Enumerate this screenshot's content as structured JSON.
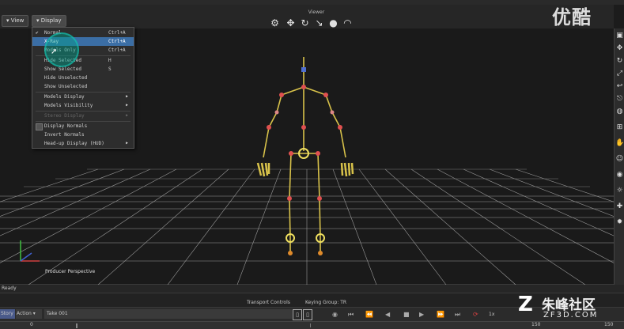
{
  "viewer": {
    "title": "Viewer",
    "view_button": "View",
    "display_button": "Display",
    "camera_label": "Producer Perspective"
  },
  "menu": {
    "items": [
      {
        "label": "Normal",
        "shortcut": "Ctrl+A",
        "checked": true
      },
      {
        "label": "X-Ray",
        "shortcut": "Ctrl+A",
        "highlighted": true
      },
      {
        "label": "Models Only",
        "shortcut": "Ctrl+A"
      },
      {
        "label": "Hide Selected",
        "shortcut": "H"
      },
      {
        "label": "Show Selected",
        "shortcut": "S"
      },
      {
        "label": "Hide Unselected",
        "shortcut": ""
      },
      {
        "label": "Show Unselected",
        "shortcut": ""
      },
      {
        "label": "Models Display",
        "submenu": true
      },
      {
        "label": "Models Visibility",
        "submenu": true
      },
      {
        "label": "Stereo Display",
        "disabled": true
      },
      {
        "label": "Display Normals",
        "checkbox": true
      },
      {
        "label": "Invert Normals"
      },
      {
        "label": "Head-up Display (HUD)",
        "submenu": true
      }
    ]
  },
  "status": {
    "text": "Ready"
  },
  "transport": {
    "header": "Transport Controls",
    "keying_group": "Keying Group: TR",
    "story_tab": "Story",
    "action_tab": "Action",
    "take": "Take 001",
    "speed": "1x",
    "start_frame": "0",
    "end_frame": "150",
    "end_frame_right": "150"
  },
  "watermark": {
    "logo_text": "优酷",
    "site_name": "朱峰社区",
    "site_url": "ZF3D.COM"
  },
  "colors": {
    "accent": "#3b6ea5",
    "skeleton": "#d8c24a",
    "joint": "#e05050"
  }
}
